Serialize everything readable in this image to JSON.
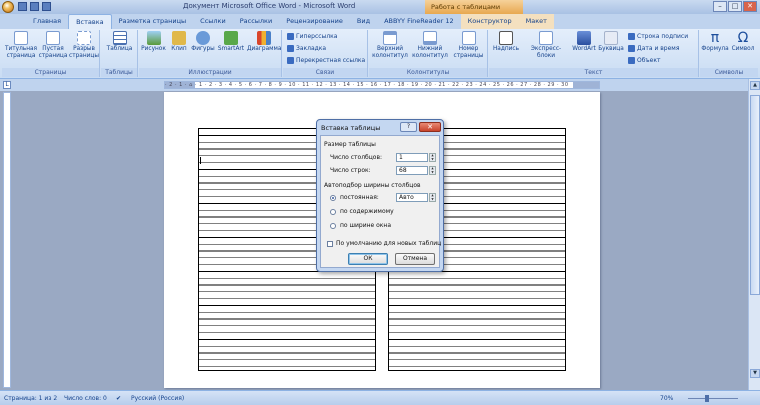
{
  "window": {
    "title": "Документ Microsoft Office Word - Microsoft Word",
    "context_title": "Работа с таблицами",
    "min": "–",
    "max": "□",
    "close": "✕"
  },
  "tabs": [
    "Главная",
    "Вставка",
    "Разметка страницы",
    "Ссылки",
    "Рассылки",
    "Рецензирование",
    "Вид",
    "ABBYY FineReader 12",
    "Конструктор",
    "Макет"
  ],
  "ribbon": {
    "groups": {
      "pages": "Страницы",
      "tables": "Таблицы",
      "illustrations": "Иллюстрации",
      "links": "Связи",
      "header_footer": "Колонтитулы",
      "text": "Текст",
      "symbols": "Символы"
    },
    "pages": {
      "title_page": "Титульная страница",
      "blank_page": "Пустая страница",
      "page_break": "Разрыв страницы"
    },
    "table": "Таблица",
    "illustrations": [
      "Рисунок",
      "Клип",
      "Фигуры",
      "SmartArt",
      "Диаграмма"
    ],
    "links": [
      "Гиперссылка",
      "Закладка",
      "Перекрестная ссылка"
    ],
    "header_footer": [
      "Верхний колонтитул",
      "Нижний колонтитул",
      "Номер страницы"
    ],
    "text": {
      "textbox": "Надпись",
      "quickparts": "Экспресс-блоки",
      "wordart": "WordArt",
      "dropcap": "Буквица",
      "sigline": "Строка подписи",
      "datetime": "Дата и время",
      "object": "Объект"
    },
    "symbols": {
      "formula": "Формула",
      "symbol": "Символ",
      "pi": "π",
      "omega": "Ω"
    }
  },
  "ruler": {
    "ticks": "· 2 · 1 · ⌂ · 1 · 2 · 3 · 4 · 5 · 6 · 7 · 8 · 9 · 10 · 11 · 12 · 13 · 14 · 15 · 16 · 17 · 18 · 19 · 20 · 21 · 22 · 23 · 24 · 25 · 26 · 27 · 28 · 29 · 30"
  },
  "dialog": {
    "title": "Вставка таблицы",
    "help": "?",
    "close": "✕",
    "size_section": "Размер таблицы",
    "columns_label": "Число столбцов:",
    "columns_value": "1",
    "rows_label": "Число строк:",
    "rows_value": "68",
    "autofit_section": "Автоподбор ширины столбцов",
    "fixed_label": "постоянная:",
    "fixed_value": "Авто",
    "content_label": "по содержимому",
    "window_label": "по ширине окна",
    "default_label": "По умолчанию для новых таблиц",
    "ok": "ОК",
    "cancel": "Отмена"
  },
  "status": {
    "page": "Страница: 1 из 2",
    "words": "Число слов: 0",
    "language": "Русский (Россия)",
    "zoom": "70%"
  }
}
